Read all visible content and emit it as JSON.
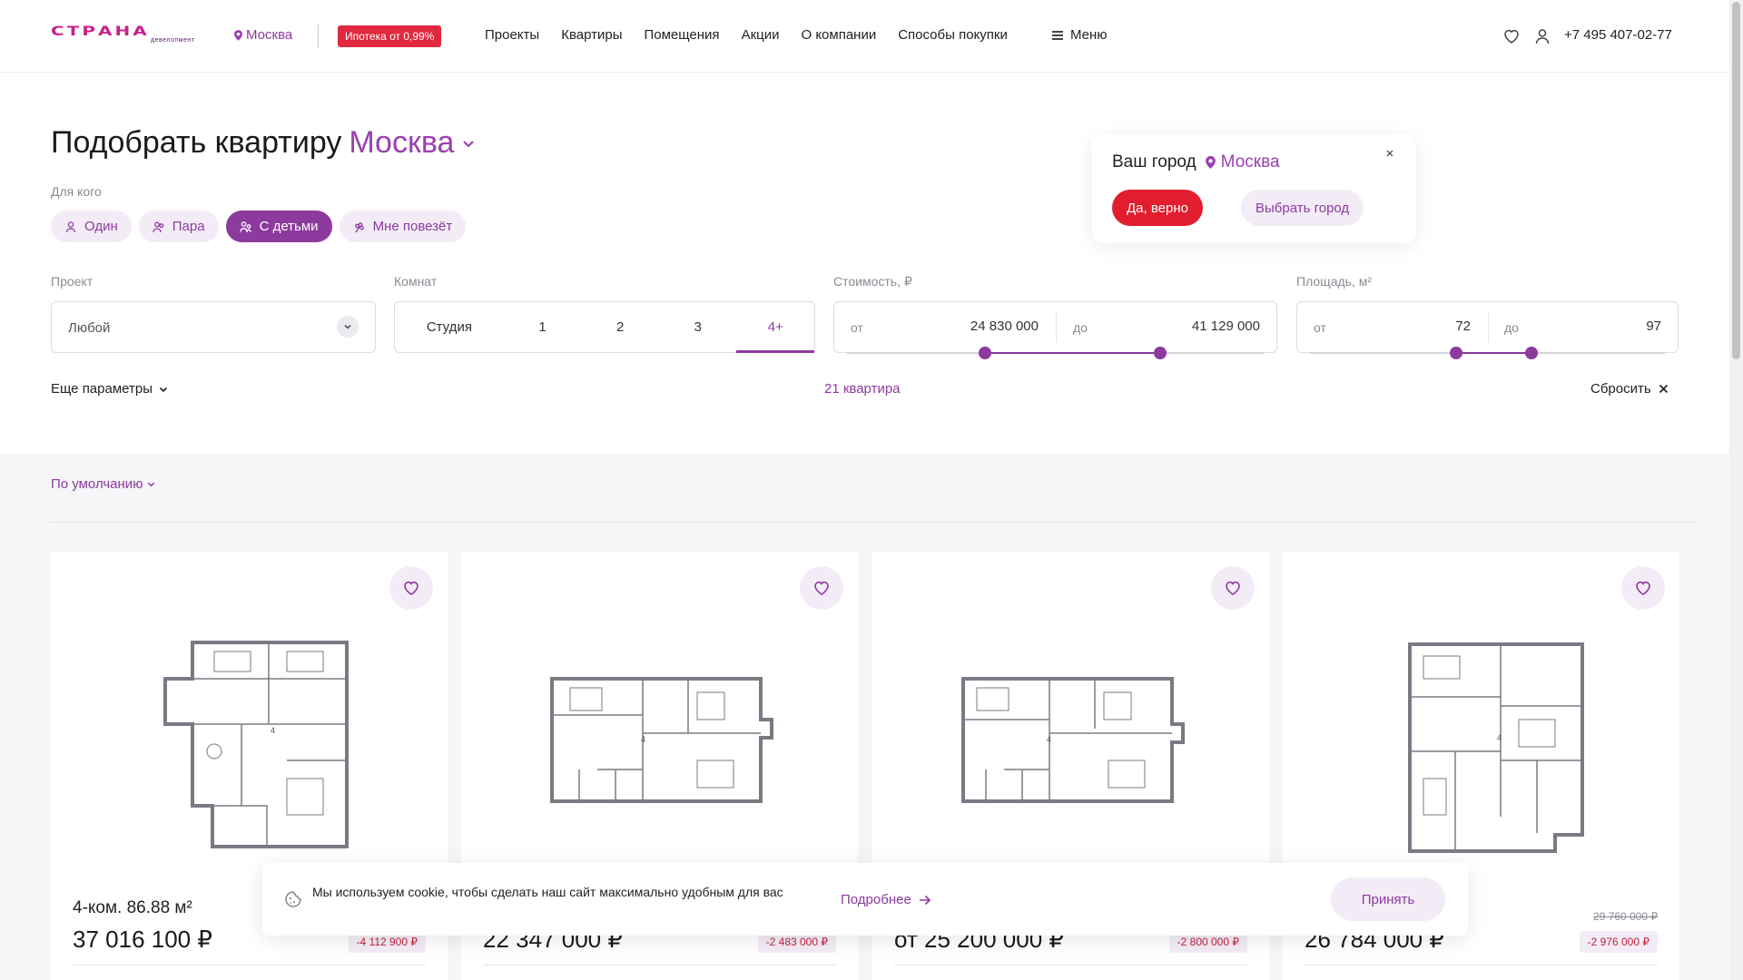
{
  "header": {
    "logo_text": "СТРАНА",
    "logo_sub": "девелопмент",
    "city": "Москва",
    "promo": "Ипотека от 0,99%",
    "nav": [
      "Проекты",
      "Квартиры",
      "Помещения",
      "Акции",
      "О компании",
      "Способы покупки"
    ],
    "menu_label": "Меню",
    "phone": "+7 495 407-02-77"
  },
  "filter": {
    "title": "Подобрать квартиру",
    "title_city": "Москва",
    "for_label": "Для кого",
    "chips": [
      {
        "label": "Один",
        "icon": "person-icon",
        "active": false
      },
      {
        "label": "Пара",
        "icon": "couple-icon",
        "active": false
      },
      {
        "label": "С детьми",
        "icon": "family-icon",
        "active": true
      },
      {
        "label": "Мне повезёт",
        "icon": "clover-icon",
        "active": false
      }
    ],
    "project_label": "Проект",
    "project_value": "Любой",
    "rooms_label": "Комнат",
    "rooms": [
      "Студия",
      "1",
      "2",
      "3",
      "4+"
    ],
    "rooms_selected": "4+",
    "price_label": "Стоимость, ₽",
    "price_from_label": "от",
    "price_from": "24 830 000",
    "price_to_label": "до",
    "price_to": "41 129 000",
    "area_label": "Площадь, м²",
    "area_from_label": "от",
    "area_from": "72",
    "area_to_label": "до",
    "area_to": "97",
    "more_params": "Еще параметры",
    "found": "21 квартира",
    "reset": "Сбросить"
  },
  "city_popover": {
    "question": "Ваш город",
    "city": "Москва",
    "confirm": "Да, верно",
    "choose": "Выбрать город"
  },
  "listing": {
    "sort": "По умолчанию",
    "cards": [
      {
        "type": "4-ком. 86.88 м²",
        "old_price": "",
        "price": "37 016 100 ₽",
        "discount": "-4 112 900 ₽"
      },
      {
        "type": "",
        "old_price": "",
        "price": "22 347 000 ₽",
        "discount": "-2 483 000 ₽"
      },
      {
        "type": "",
        "old_price": "",
        "price": "от 25 200 000 ₽",
        "discount": "-2 800 000 ₽"
      },
      {
        "type": "",
        "old_price": "29 760 000 ₽",
        "price": "26 784 000 ₽",
        "discount": "-2 976 000 ₽"
      }
    ]
  },
  "cookie": {
    "text": "Мы используем cookie, чтобы сделать наш сайт максимально удобным для вас",
    "more": "Подробнее",
    "accept": "Принять"
  },
  "colors": {
    "accent": "#8c3a9e",
    "brand": "#c8218a",
    "red": "#e11d2f",
    "chip_bg": "#f3ecf6"
  }
}
